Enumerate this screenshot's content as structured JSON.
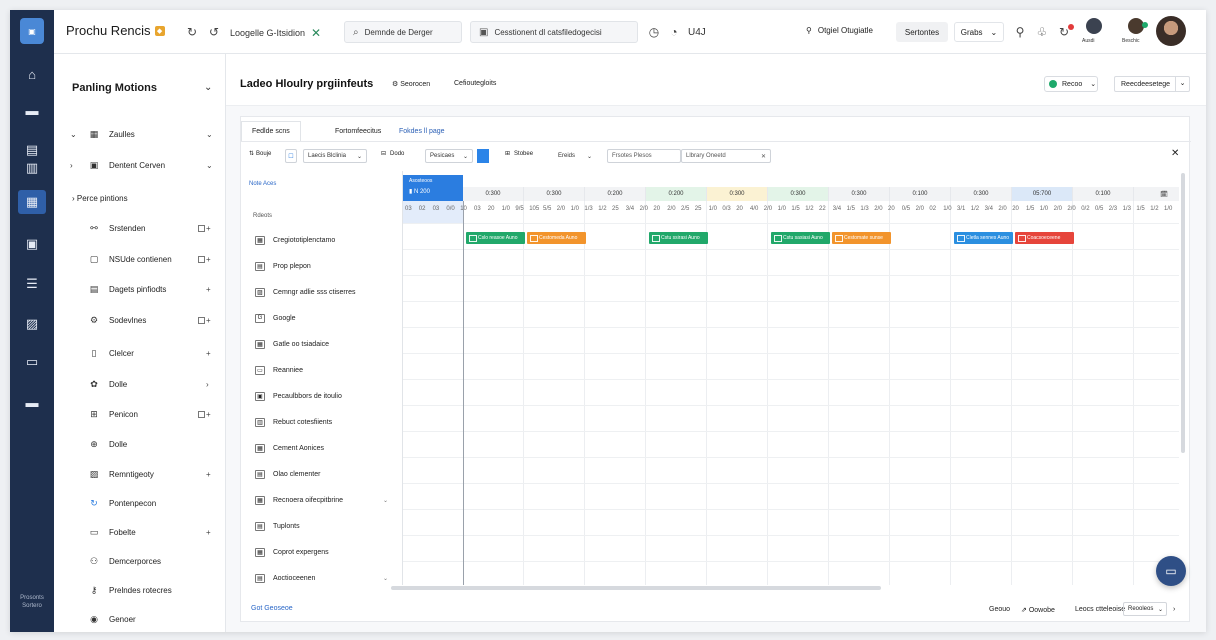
{
  "topbar": {
    "app_name": "Prochu Rencis",
    "tab_label": "Loogelle G-Itsidion",
    "search_placeholder": "Demnde de Derger",
    "collection_label": "Cesstionent dl catsfiledogecisi",
    "timer_text": "U4J",
    "location_label": "Otgiel Otugiatle",
    "settings_label": "Sertontes",
    "menu_label": "Grabs",
    "user_mini_1": "Ausdi",
    "user_mini_2": "Beschic"
  },
  "rail": {
    "bottom_label": "Prosonts Sortero"
  },
  "sidebar": {
    "title": "Panling Motions",
    "items": [
      {
        "label": "Zaulles",
        "icon": "grid-icon",
        "caret": "⌄",
        "tail": "⌄"
      },
      {
        "label": "Dentent Cerven",
        "icon": "card-icon",
        "caret": "›",
        "tail": "⌄"
      }
    ],
    "section_label": "Perce pintions",
    "sub_items": [
      {
        "label": "Srstenden",
        "icon": "link-icon",
        "tail": "+"
      },
      {
        "label": "NSUde contienen",
        "icon": "chat-icon",
        "tail": "+"
      },
      {
        "label": "Dagets pinfiodts",
        "icon": "calendar-icon",
        "tail": "+"
      },
      {
        "label": "Sodevlnes",
        "icon": "gear-icon",
        "tail": "+"
      },
      {
        "label": "Clelcer",
        "icon": "doc-icon",
        "tail": "+"
      },
      {
        "label": "Dolle",
        "icon": "settings-icon",
        "tail": "›"
      },
      {
        "label": "Penicon",
        "icon": "table-icon",
        "tail": "+"
      },
      {
        "label": "Dolle",
        "icon": "globe-icon",
        "tail": ""
      },
      {
        "label": "Remntigeoty",
        "icon": "image-icon",
        "tail": "+"
      },
      {
        "label": "Pontenpecon",
        "icon": "refresh-icon",
        "tail": ""
      },
      {
        "label": "Fobelte",
        "icon": "folder-icon",
        "tail": "+"
      },
      {
        "label": "Demcerporces",
        "icon": "users-icon",
        "tail": ""
      },
      {
        "label": "Prelndes rotecres",
        "icon": "key-icon",
        "tail": ""
      },
      {
        "label": "Genoer",
        "icon": "clock-icon",
        "tail": ""
      }
    ]
  },
  "main": {
    "title": "Ladeo Hloulry prgiinfeuts",
    "link_1": "Seorocen",
    "link_2": "Cefioutegloits",
    "status_label": "Recoo",
    "select_label": "Reecdeesetege",
    "tabs": [
      "Fedlde scns",
      "Fortomfeecitus",
      "Fokdes ll page"
    ],
    "toolbar": {
      "label_1": "Bouje",
      "box_1": "Laecis Blclinia",
      "label_2": "Dodo",
      "box_2": "Pesicaes",
      "label_3": "Stobee",
      "box_3": "Ereids",
      "filter_left": "Frsotes Plesos",
      "filter_right": "Llbrary Oneetd"
    }
  },
  "gantt": {
    "name_header": "Note Aces",
    "name_sub": "Rdeots",
    "selected_header": "Asosteoos",
    "selected_value": "N 200",
    "columns": [
      {
        "label": "0:300",
        "color": "#f2f3f5"
      },
      {
        "label": "0:300",
        "color": "#f2f3f5"
      },
      {
        "label": "0:200",
        "color": "#f2f3f5"
      },
      {
        "label": "0:200",
        "color": "#e3f4e8"
      },
      {
        "label": "0:300",
        "color": "#fbf2d3"
      },
      {
        "label": "0:300",
        "color": "#e3f4e8"
      },
      {
        "label": "0:300",
        "color": "#f2f3f5"
      },
      {
        "label": "0:100",
        "color": "#f2f3f5"
      },
      {
        "label": "0:300",
        "color": "#f2f3f5"
      },
      {
        "label": "05:700",
        "color": "#dbe8f8"
      },
      {
        "label": "0:100",
        "color": "#f2f3f5"
      },
      {
        "label": "🗓",
        "color": "#f2f3f5"
      }
    ],
    "sub_ticks": [
      "03",
      "02",
      "03",
      "0/0",
      "10",
      "03",
      "20",
      "1/0",
      "9/5",
      "105",
      "5/5",
      "2/0",
      "1/0",
      "1/3",
      "1/2",
      "25",
      "3/4",
      "2/0",
      "20",
      "2/0",
      "2/5",
      "25",
      "1/0",
      "0/3",
      "20",
      "4/0",
      "2/0",
      "1/0",
      "1/5",
      "1/2",
      "22",
      "3/4",
      "1/5",
      "1/3",
      "2/0",
      "20",
      "0/5",
      "2/0",
      "02",
      "1/0",
      "3/1",
      "1/2",
      "3/4",
      "2/0",
      "20",
      "1/5",
      "1/0",
      "2/0",
      "2/0",
      "0/2",
      "0/5",
      "2/3",
      "1/3",
      "1/5",
      "1/2",
      "1/0"
    ],
    "tasks": [
      {
        "label": "Cregiototiplenctamo",
        "icon": "▦"
      },
      {
        "label": "Prop plepon",
        "icon": "▤"
      },
      {
        "label": "Cemngr adlie sss ctiserres",
        "icon": "▨"
      },
      {
        "label": "Google",
        "icon": "G"
      },
      {
        "label": "Gatle oo tsiadaice",
        "icon": "▦"
      },
      {
        "label": "Reanniee",
        "icon": "▭"
      },
      {
        "label": "Pecaulbbors de itoulio",
        "icon": "▣"
      },
      {
        "label": "Rebuct cotesfiients",
        "icon": "▥"
      },
      {
        "label": "Cement Aonices",
        "icon": "▦"
      },
      {
        "label": "Olao clementer",
        "icon": "▤"
      },
      {
        "label": "Recnoera oifecpitbrine",
        "icon": "▦"
      },
      {
        "label": "Tuplonts",
        "icon": "▤"
      },
      {
        "label": "Coprot expergens",
        "icon": "▦"
      },
      {
        "label": "Aoctioceenen",
        "icon": "▤"
      }
    ],
    "bars": [
      {
        "label": "Cslo reasoe Auno",
        "color": "#21a86a",
        "col": 1
      },
      {
        "label": "Cestomeda Auno",
        "color": "#f2942c",
        "col": 2
      },
      {
        "label": "Cstu ssirasi Auno",
        "color": "#21a86a",
        "col": 4
      },
      {
        "label": "Cstu sasiasi Auno",
        "color": "#21a86a",
        "col": 6
      },
      {
        "label": "Cestomate sunse",
        "color": "#f2942c",
        "col": 7
      },
      {
        "label": "Cletla sennes Auno",
        "color": "#2b8fe0",
        "col": 9
      },
      {
        "label": "Coacsoeceene",
        "color": "#e6453b",
        "col": 10
      }
    ]
  },
  "footer": {
    "left_label": "Got Geoseoe",
    "item_1": "Geouo",
    "item_2": "Oowobe",
    "item_3": "Leocs ctteleoise",
    "select_label": "Reooleos"
  },
  "colors": {
    "rail": "#1e2f4d",
    "accent": "#2b7de0",
    "green": "#21a86a",
    "orange": "#f2942c",
    "red": "#e6453b"
  }
}
